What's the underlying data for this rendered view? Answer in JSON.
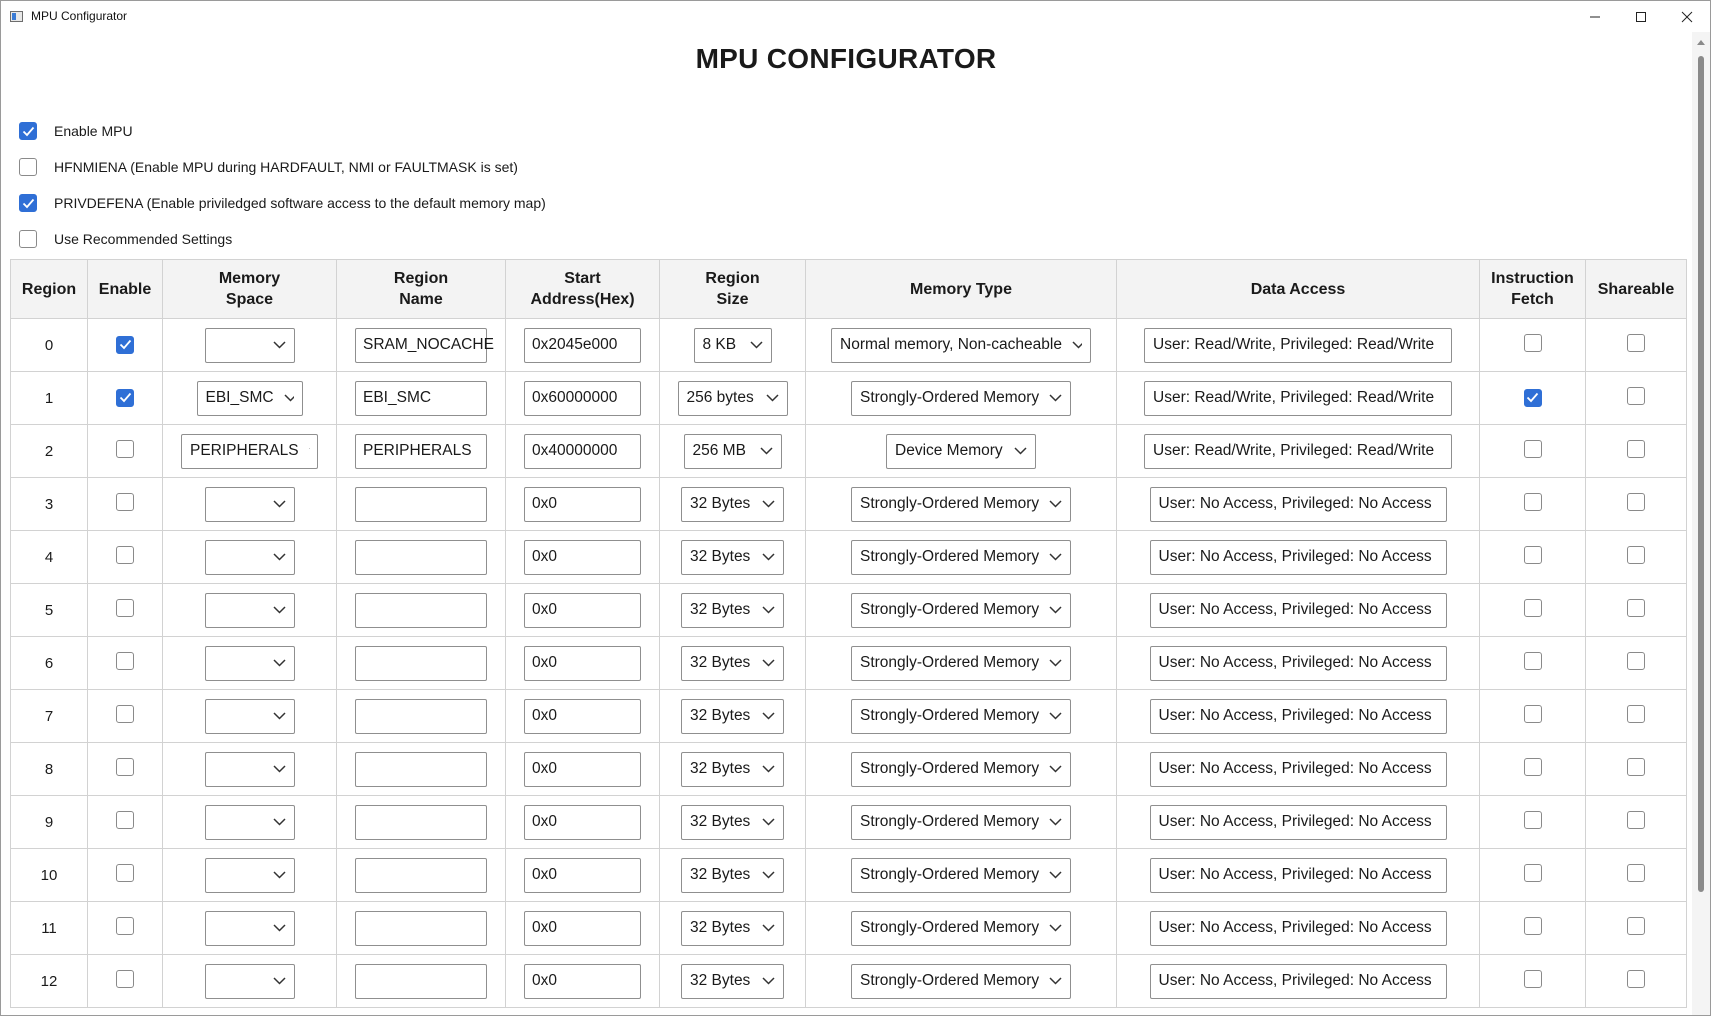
{
  "window": {
    "title": "MPU Configurator"
  },
  "page": {
    "title": "MPU CONFIGURATOR"
  },
  "options": [
    {
      "label": "Enable MPU",
      "checked": true
    },
    {
      "label": "HFNMIENA (Enable MPU during HARDFAULT, NMI or FAULTMASK is set)",
      "checked": false
    },
    {
      "label": "PRIVDEFENA (Enable priviledged software access to the default memory map)",
      "checked": true
    },
    {
      "label": "Use Recommended Settings",
      "checked": false
    }
  ],
  "table": {
    "headers": [
      "Region",
      "Enable",
      "Memory Space",
      "Region Name",
      "Start Address(Hex)",
      "Region Size",
      "Memory Type",
      "Data Access",
      "Instruction Fetch",
      "Shareable"
    ],
    "rows": [
      {
        "region": "0",
        "enable": true,
        "memory_space": "",
        "region_name": "SRAM_NOCACHE",
        "start_address": "0x2045e000",
        "region_size": "8 KB",
        "memory_type": "Normal memory, Non-cacheable",
        "data_access": "User: Read/Write, Privileged: Read/Write",
        "instruction_fetch": false,
        "shareable": false
      },
      {
        "region": "1",
        "enable": true,
        "memory_space": "EBI_SMC",
        "region_name": "EBI_SMC",
        "start_address": "0x60000000",
        "region_size": "256 bytes",
        "memory_type": "Strongly-Ordered Memory",
        "data_access": "User: Read/Write, Privileged: Read/Write",
        "instruction_fetch": true,
        "shareable": false
      },
      {
        "region": "2",
        "enable": false,
        "memory_space": "PERIPHERALS",
        "region_name": "PERIPHERALS",
        "start_address": "0x40000000",
        "region_size": "256 MB",
        "memory_type": "Device Memory",
        "data_access": "User: Read/Write, Privileged: Read/Write",
        "instruction_fetch": false,
        "shareable": false
      },
      {
        "region": "3",
        "enable": false,
        "memory_space": "",
        "region_name": "",
        "start_address": "0x0",
        "region_size": "32 Bytes",
        "memory_type": "Strongly-Ordered Memory",
        "data_access": "User: No Access, Privileged: No Access",
        "instruction_fetch": false,
        "shareable": false
      },
      {
        "region": "4",
        "enable": false,
        "memory_space": "",
        "region_name": "",
        "start_address": "0x0",
        "region_size": "32 Bytes",
        "memory_type": "Strongly-Ordered Memory",
        "data_access": "User: No Access, Privileged: No Access",
        "instruction_fetch": false,
        "shareable": false
      },
      {
        "region": "5",
        "enable": false,
        "memory_space": "",
        "region_name": "",
        "start_address": "0x0",
        "region_size": "32 Bytes",
        "memory_type": "Strongly-Ordered Memory",
        "data_access": "User: No Access, Privileged: No Access",
        "instruction_fetch": false,
        "shareable": false
      },
      {
        "region": "6",
        "enable": false,
        "memory_space": "",
        "region_name": "",
        "start_address": "0x0",
        "region_size": "32 Bytes",
        "memory_type": "Strongly-Ordered Memory",
        "data_access": "User: No Access, Privileged: No Access",
        "instruction_fetch": false,
        "shareable": false
      },
      {
        "region": "7",
        "enable": false,
        "memory_space": "",
        "region_name": "",
        "start_address": "0x0",
        "region_size": "32 Bytes",
        "memory_type": "Strongly-Ordered Memory",
        "data_access": "User: No Access, Privileged: No Access",
        "instruction_fetch": false,
        "shareable": false
      },
      {
        "region": "8",
        "enable": false,
        "memory_space": "",
        "region_name": "",
        "start_address": "0x0",
        "region_size": "32 Bytes",
        "memory_type": "Strongly-Ordered Memory",
        "data_access": "User: No Access, Privileged: No Access",
        "instruction_fetch": false,
        "shareable": false
      },
      {
        "region": "9",
        "enable": false,
        "memory_space": "",
        "region_name": "",
        "start_address": "0x0",
        "region_size": "32 Bytes",
        "memory_type": "Strongly-Ordered Memory",
        "data_access": "User: No Access, Privileged: No Access",
        "instruction_fetch": false,
        "shareable": false
      },
      {
        "region": "10",
        "enable": false,
        "memory_space": "",
        "region_name": "",
        "start_address": "0x0",
        "region_size": "32 Bytes",
        "memory_type": "Strongly-Ordered Memory",
        "data_access": "User: No Access, Privileged: No Access",
        "instruction_fetch": false,
        "shareable": false
      },
      {
        "region": "11",
        "enable": false,
        "memory_space": "",
        "region_name": "",
        "start_address": "0x0",
        "region_size": "32 Bytes",
        "memory_type": "Strongly-Ordered Memory",
        "data_access": "User: No Access, Privileged: No Access",
        "instruction_fetch": false,
        "shareable": false
      },
      {
        "region": "12",
        "enable": false,
        "memory_space": "",
        "region_name": "",
        "start_address": "0x0",
        "region_size": "32 Bytes",
        "memory_type": "Strongly-Ordered Memory",
        "data_access": "User: No Access, Privileged: No Access",
        "instruction_fetch": false,
        "shareable": false
      }
    ]
  },
  "colors": {
    "accent": "#2f6fd6",
    "header_bg": "#f3f3f3",
    "grid_line": "#d2d2d2",
    "control_border": "#8f8f8f"
  },
  "icons": {
    "minimize": "minimize-icon",
    "maximize": "maximize-icon",
    "close": "close-icon",
    "dropdown": "chevron-down-icon",
    "check": "checkmark-icon"
  }
}
